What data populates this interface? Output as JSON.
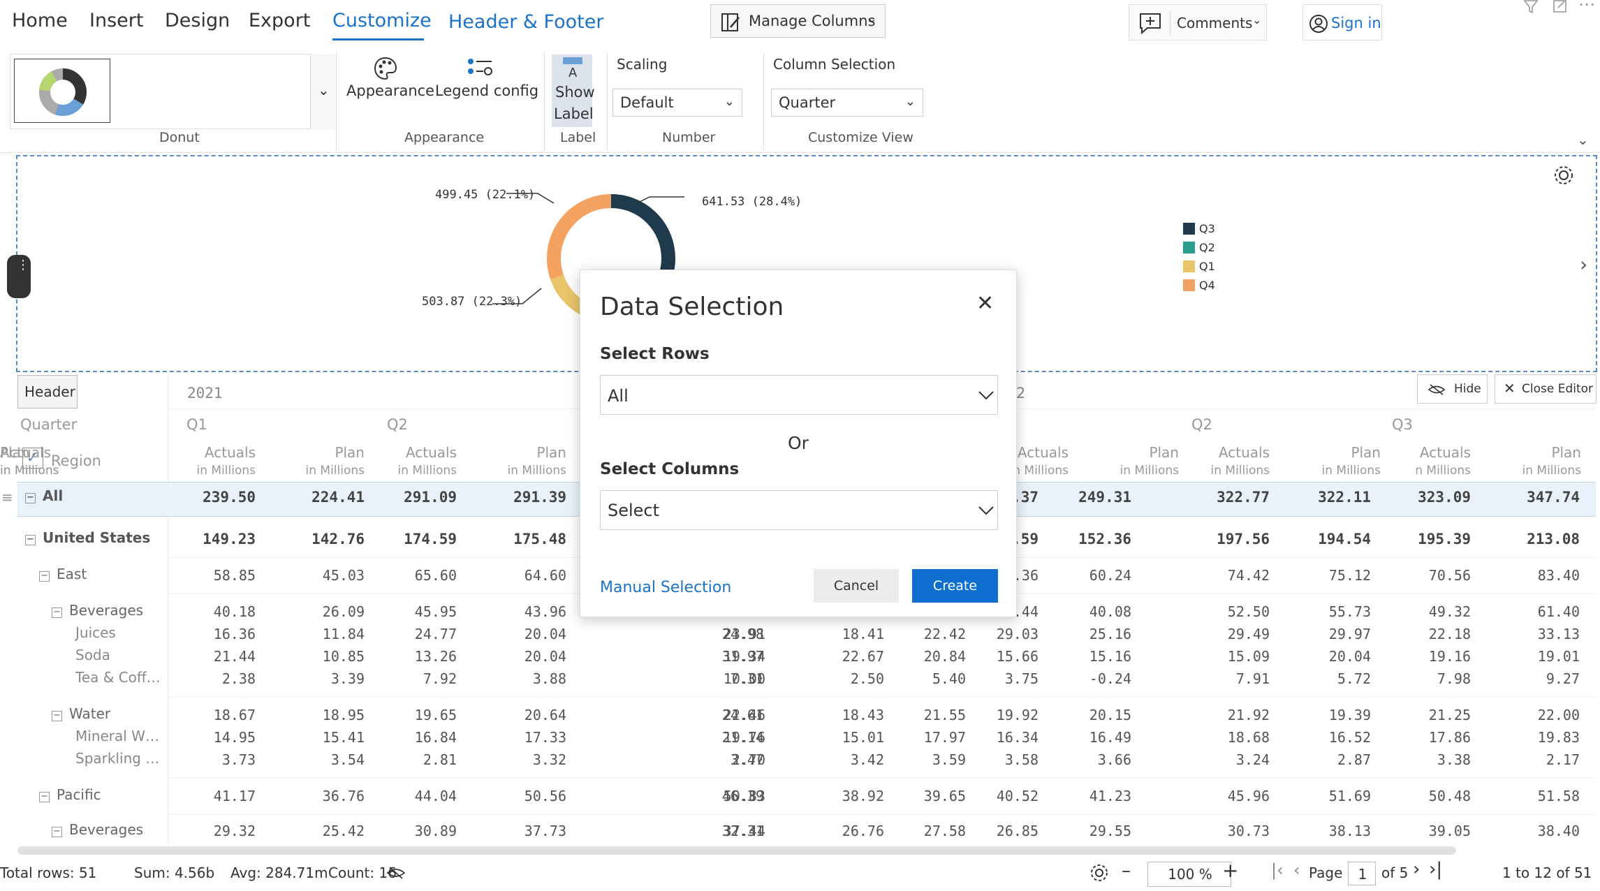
{
  "menu": {
    "tabs": [
      "Home",
      "Insert",
      "Design",
      "Export",
      "Customize",
      "Header & Footer"
    ],
    "active_tab": "Customize",
    "manage_columns": "Manage Columns",
    "comments": "Comments",
    "sign_in": "Sign in"
  },
  "ribbon": {
    "chart_group_label": "Donut",
    "appearance": "Appearance",
    "legend_config": "Legend config",
    "appearance_group_label": "Appearance",
    "show": "Show",
    "label": "Label",
    "label_group_label": "Label",
    "scaling_title": "Scaling",
    "scaling_value": "Default",
    "number_group_label": "Number",
    "column_selection_title": "Column Selection",
    "column_selection_value": "Quarter",
    "customize_view_label": "Customize View"
  },
  "chart_data": {
    "type": "pie",
    "donut": true,
    "categories": [
      "Q3",
      "Q2",
      "Q1",
      "Q4"
    ],
    "values": [
      641.53,
      0,
      503.87,
      499.45
    ],
    "data_labels": {
      "q3": "641.53 (28.4%)",
      "q1": "503.87 (22.3%)",
      "q4": "499.45 (22.1%)"
    },
    "colors": [
      "#1f3a4d",
      "#2a9d8f",
      "#e9c46a",
      "#f4a261"
    ],
    "legend": [
      "Q3",
      "Q2",
      "Q1",
      "Q4"
    ],
    "legend_position": "right"
  },
  "editor": {
    "header_tab": "Header",
    "hide": "Hide",
    "close_editor": "Close Editor"
  },
  "dialog": {
    "title": "Data Selection",
    "select_rows_label": "Select Rows",
    "rows_value": "All",
    "or": "Or",
    "select_columns_label": "Select Columns",
    "columns_value": "Select",
    "manual_selection": "Manual Selection",
    "cancel": "Cancel",
    "create": "Create"
  },
  "grid": {
    "year_left": "2021",
    "year_right": "2",
    "quarter_header": "Quarter",
    "region_header": "Region",
    "quarters": [
      "Q1",
      "Q2",
      "Q2",
      "Q3"
    ],
    "col_headers": [
      "Actuals",
      "Plan",
      "Actuals",
      "Plan",
      "Actuals",
      "Plan",
      "Actuals",
      "Plan",
      "Actuals",
      "Plan",
      "Actuals",
      "Plan"
    ],
    "col_subs": [
      "in Millions",
      "in Millions",
      "in Millions",
      "in Millions",
      "in Millions",
      "in Millions",
      "in Millions",
      "in Millions",
      "n Millions",
      "in Millions",
      "in Millions",
      "in Millions"
    ],
    "rows": [
      {
        "label": "All",
        "level": 0,
        "toggle": "⊟",
        "bold": true,
        "cells": [
          "239.50",
          "224.41",
          "291.09",
          "291.39",
          "",
          "",
          "",
          "",
          "264.37",
          "249.31",
          "322.77",
          "322.11",
          "323.09",
          "347.74"
        ]
      },
      {
        "label": "United States",
        "level": 0,
        "toggle": "⊟",
        "bold": true,
        "cells": [
          "149.23",
          "142.76",
          "174.59",
          "175.48",
          "",
          "",
          "",
          "",
          "158.59",
          "152.36",
          "197.56",
          "194.54",
          "195.39",
          "213.08"
        ]
      },
      {
        "label": "East",
        "level": 1,
        "toggle": "⊟",
        "bold": false,
        "cells": [
          "58.85",
          "45.03",
          "65.60",
          "64.60",
          "",
          "",
          "",
          "",
          "68.36",
          "60.24",
          "74.42",
          "75.12",
          "70.56",
          "83.40"
        ]
      },
      {
        "label": "Beverages",
        "level": 2,
        "toggle": "⊟",
        "bold": false,
        "cells": [
          "40.18",
          "26.09",
          "45.95",
          "43.96",
          "",
          "",
          "",
          "",
          "48.44",
          "40.08",
          "52.50",
          "55.73",
          "49.32",
          "61.40"
        ]
      },
      {
        "label": "Juices",
        "level": 3,
        "toggle": "",
        "bold": false,
        "cells": [
          "16.36",
          "11.84",
          "24.77",
          "20.04",
          "23.91",
          "24.98",
          "18.41",
          "22.42",
          "29.03",
          "25.16",
          "29.49",
          "29.97",
          "22.18",
          "33.13"
        ]
      },
      {
        "label": "Soda",
        "level": 3,
        "toggle": "",
        "bold": false,
        "cells": [
          "21.44",
          "10.85",
          "13.26",
          "20.04",
          "19.34",
          "31.97",
          "22.67",
          "20.84",
          "15.66",
          "15.16",
          "15.09",
          "20.04",
          "19.16",
          "19.01"
        ]
      },
      {
        "label": "Tea & Coff…",
        "level": 3,
        "toggle": "",
        "bold": false,
        "cells": [
          "2.38",
          "3.39",
          "7.92",
          "3.88",
          "10.00",
          "7.31",
          "2.50",
          "5.40",
          "3.75",
          "-0.24",
          "7.91",
          "5.72",
          "7.98",
          "9.27"
        ]
      },
      {
        "label": "Water",
        "level": 2,
        "toggle": "⊟",
        "bold": false,
        "cells": [
          "18.67",
          "18.95",
          "19.65",
          "20.64",
          "22.46",
          "24.61",
          "18.43",
          "21.55",
          "19.92",
          "20.15",
          "21.92",
          "19.39",
          "21.25",
          "22.00"
        ]
      },
      {
        "label": "Mineral W…",
        "level": 3,
        "toggle": "",
        "bold": false,
        "cells": [
          "14.95",
          "15.41",
          "16.84",
          "17.33",
          "19.76",
          "21.14",
          "15.01",
          "17.97",
          "16.34",
          "16.49",
          "18.68",
          "16.52",
          "17.86",
          "19.83"
        ]
      },
      {
        "label": "Sparkling …",
        "level": 3,
        "toggle": "",
        "bold": false,
        "cells": [
          "3.73",
          "3.54",
          "2.81",
          "3.32",
          "2.70",
          "3.47",
          "3.42",
          "3.59",
          "3.58",
          "3.66",
          "3.24",
          "2.87",
          "3.38",
          "2.17"
        ]
      },
      {
        "label": "Pacific",
        "level": 1,
        "toggle": "⊟",
        "bold": false,
        "cells": [
          "41.17",
          "36.76",
          "44.04",
          "50.56",
          "50.83",
          "46.39",
          "38.92",
          "39.65",
          "40.52",
          "41.23",
          "45.96",
          "51.69",
          "50.48",
          "51.58"
        ]
      },
      {
        "label": "Beverages",
        "level": 2,
        "toggle": "⊟",
        "bold": false,
        "cells": [
          "29.32",
          "25.42",
          "30.89",
          "37.73",
          "37.44",
          "32.31",
          "26.76",
          "27.58",
          "26.85",
          "29.55",
          "30.73",
          "38.13",
          "39.05",
          "38.40"
        ]
      }
    ]
  },
  "status": {
    "total_rows": "Total rows: 51",
    "sum": "Sum: 4.56b",
    "avg": "Avg: 284.71m",
    "count": "Count: 16",
    "zoom": "100 %",
    "page_label": "Page",
    "page_value": "1",
    "page_of": "of 5",
    "range": "1 to 12 of 51"
  }
}
